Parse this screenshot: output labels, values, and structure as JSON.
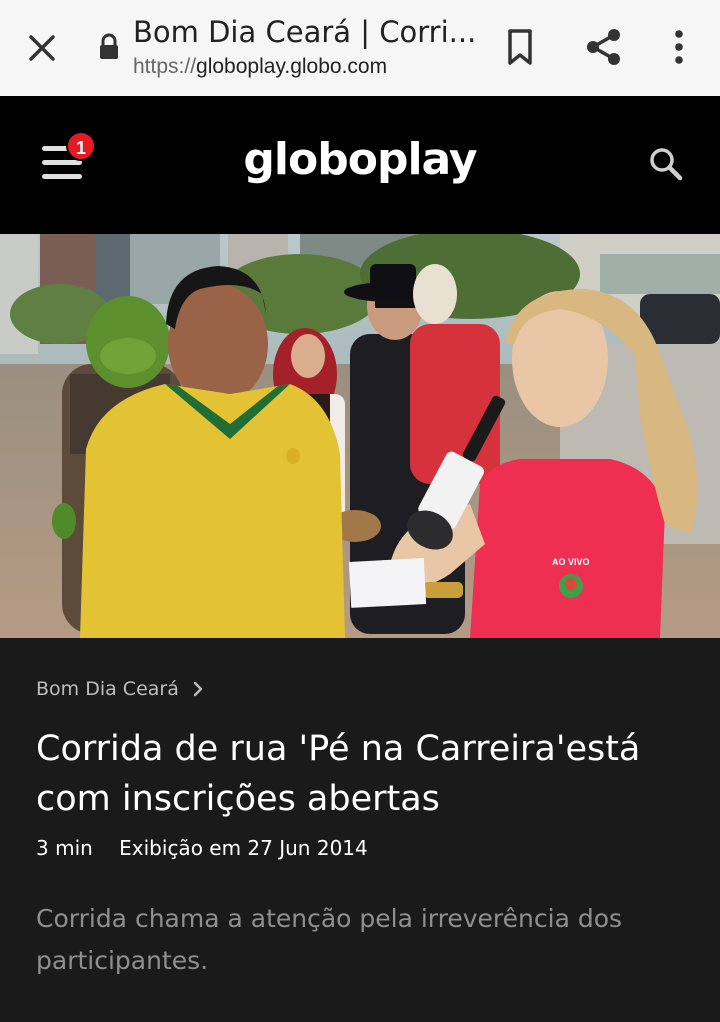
{
  "browser": {
    "tab_title": "Bom Dia Ceará | Corri...",
    "url_scheme": "https://",
    "url_host": "globoplay.globo.com"
  },
  "header": {
    "logo": "globoplay",
    "notification_count": "1"
  },
  "video": {
    "live_badge": "AO VIVO"
  },
  "episode": {
    "program": "Bom Dia Ceará",
    "title": "Corrida de rua 'Pé na Carreira'está com inscrições abertas",
    "duration": "3 min",
    "aired": "Exibição em 27 Jun 2014",
    "description": "Corrida chama a atenção pela irreverência dos participantes."
  },
  "colors": {
    "accent_red": "#e31b23",
    "header_bg": "#000000",
    "content_bg": "#1a1a1a"
  }
}
